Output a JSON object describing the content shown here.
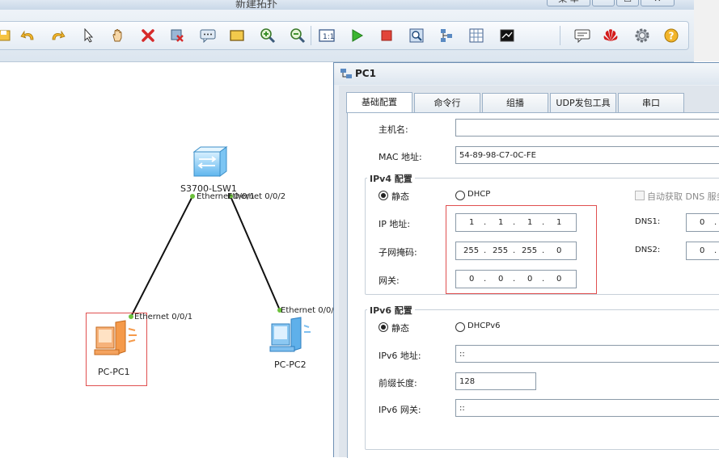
{
  "window": {
    "title": "新建拓扑",
    "controls": [
      "菜 单",
      "—",
      "☐",
      "✕"
    ]
  },
  "toolbar": {
    "icons": [
      "undo-icon",
      "redo-icon",
      "select-arrow-icon",
      "pan-hand-icon",
      "delete-icon",
      "delete-link-icon",
      "text-note-icon",
      "rectangle-icon",
      "zoom-in-icon",
      "zoom-out-icon",
      "fit-screen-icon",
      "start-device-icon",
      "stop-device-icon",
      "capture-icon",
      "topology-icon",
      "grid-icon",
      "terminal-icon",
      "chat-icon",
      "huawei-logo-icon",
      "settings-icon",
      "help-icon"
    ]
  },
  "canvas": {
    "switch": {
      "name": "S3700-LSW1",
      "port1": "Ethernet 0/0/1",
      "port2": "Ethernet 0/0/2"
    },
    "pc1": {
      "name": "PC-PC1",
      "port": "Ethernet 0/0/1"
    },
    "pc2": {
      "name": "PC-PC2",
      "port": "Ethernet 0/0/"
    }
  },
  "dialog": {
    "title": "PC1",
    "tabs": [
      "基础配置",
      "命令行",
      "组播",
      "UDP发包工具",
      "串口"
    ],
    "hostname_label": "主机名:",
    "hostname_value": "",
    "mac_label": "MAC 地址:",
    "mac_value": "54-89-98-C7-0C-FE",
    "ipv4": {
      "title": "IPv4 配置",
      "static_label": "静态",
      "dhcp_label": "DHCP",
      "auto_dns_label": "自动获取 DNS 服务",
      "ip_label": "IP 地址:",
      "ip": [
        "1",
        "1",
        "1",
        "1"
      ],
      "mask_label": "子网掩码:",
      "mask": [
        "255",
        "255",
        "255",
        "0"
      ],
      "gateway_label": "网关:",
      "gateway": [
        "0",
        "0",
        "0",
        "0"
      ],
      "dns1_label": "DNS1:",
      "dns1_first": "0",
      "dns2_label": "DNS2:",
      "dns2_first": "0"
    },
    "ipv6": {
      "title": "IPv6 配置",
      "static_label": "静态",
      "dhcp_label": "DHCPv6",
      "addr_label": "IPv6 地址:",
      "addr_value": "::",
      "prefix_label": "前缀长度:",
      "prefix_value": "128",
      "gateway_label": "IPv6 网关:",
      "gateway_value": "::"
    }
  }
}
